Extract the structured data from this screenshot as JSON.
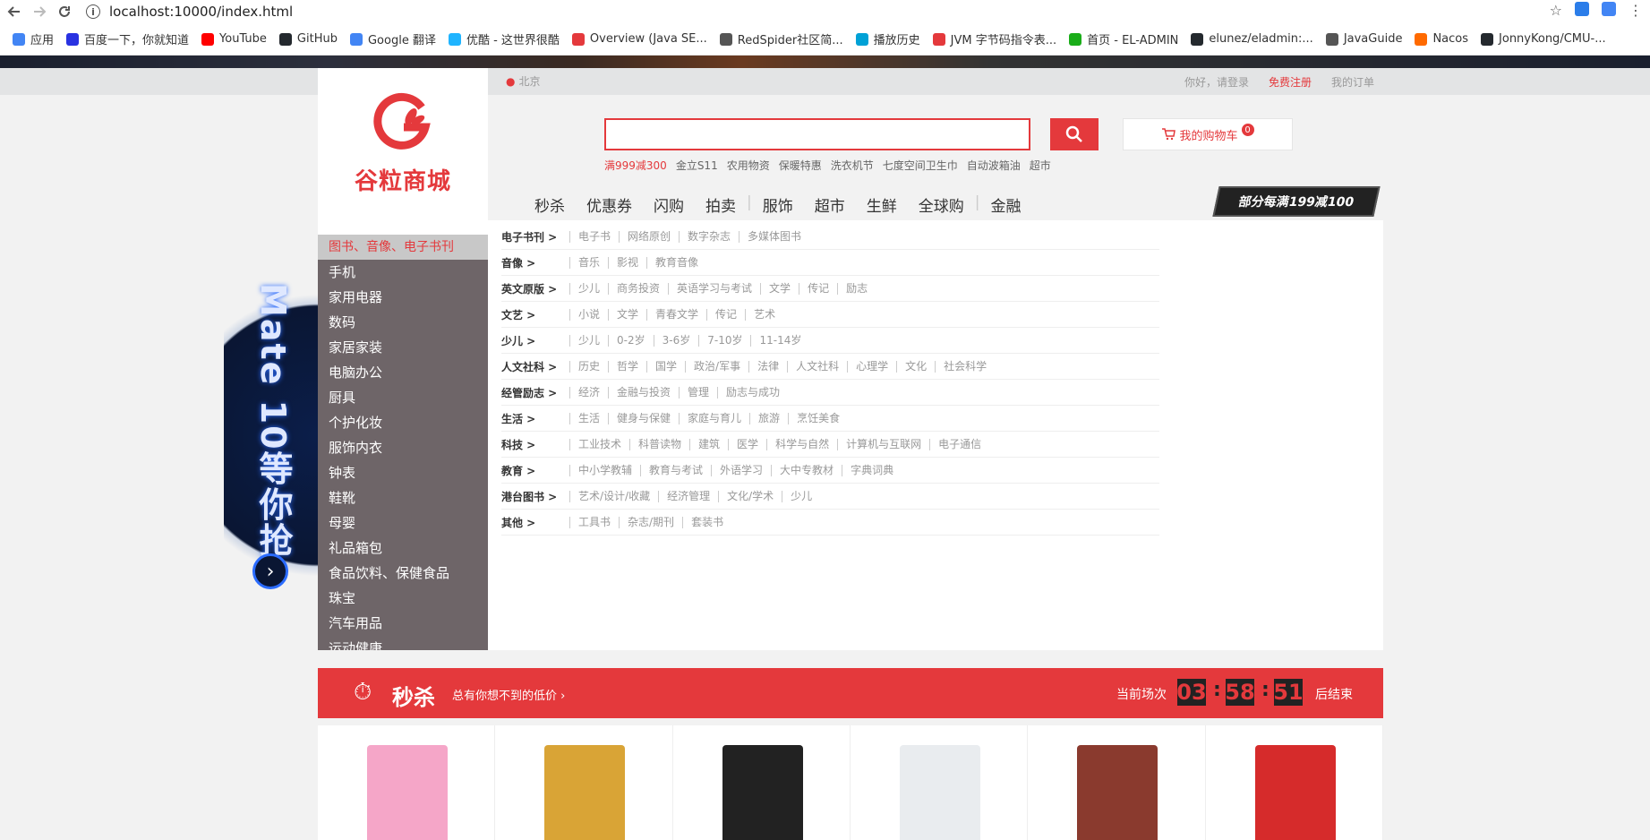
{
  "browser": {
    "url": "localhost:10000/index.html",
    "bookmarks": [
      {
        "label": "应用",
        "color": "#4285f4"
      },
      {
        "label": "百度一下，你就知道",
        "color": "#2932e1"
      },
      {
        "label": "YouTube",
        "color": "#ff0000"
      },
      {
        "label": "GitHub",
        "color": "#24292e"
      },
      {
        "label": "Google 翻译",
        "color": "#4285f4"
      },
      {
        "label": "优酷 - 这世界很酷",
        "color": "#1fb4ff"
      },
      {
        "label": "Overview (Java SE...",
        "color": "#e4393c"
      },
      {
        "label": "RedSpider社区简...",
        "color": "#555555"
      },
      {
        "label": "播放历史",
        "color": "#00a1d6"
      },
      {
        "label": "JVM 字节码指令表...",
        "color": "#e4393c"
      },
      {
        "label": "首页 - EL-ADMIN",
        "color": "#1aad19"
      },
      {
        "label": "elunez/eladmin:...",
        "color": "#24292e"
      },
      {
        "label": "JavaGuide",
        "color": "#555555"
      },
      {
        "label": "Nacos",
        "color": "#ff6a00"
      },
      {
        "label": "JonnyKong/CMU-...",
        "color": "#24292e"
      }
    ]
  },
  "top": {
    "location": "北京",
    "greeting": "你好，请登录",
    "register": "免费注册",
    "orders": "我的订单"
  },
  "header": {
    "logo_text": "谷粒商城",
    "cart_label": "我的购物车",
    "cart_count": "0",
    "hotwords": [
      "满999减300",
      "金立S11",
      "农用物资",
      "保暖特惠",
      "洗衣机节",
      "七度空间卫生巾",
      "自动波箱油",
      "超市"
    ],
    "nav": [
      "秒杀",
      "优惠券",
      "闪购",
      "拍卖",
      "服饰",
      "超市",
      "生鲜",
      "全球购",
      "金融"
    ],
    "promo": "部分每满199减100"
  },
  "hero": {
    "text": "Mate 10等你抢"
  },
  "categories": [
    "图书、音像、电子书刊",
    "手机",
    "家用电器",
    "数码",
    "家居家装",
    "电脑办公",
    "厨具",
    "个护化妆",
    "服饰内衣",
    "钟表",
    "鞋靴",
    "母婴",
    "礼品箱包",
    "食品饮料、保健食品",
    "珠宝",
    "汽车用品",
    "运动健康"
  ],
  "subcategories": [
    {
      "title": "电子书刊 >",
      "items": [
        "电子书",
        "网络原创",
        "数字杂志",
        "多媒体图书"
      ]
    },
    {
      "title": "音像 >",
      "items": [
        "音乐",
        "影视",
        "教育音像"
      ]
    },
    {
      "title": "英文原版 >",
      "items": [
        "少儿",
        "商务投资",
        "英语学习与考试",
        "文学",
        "传记",
        "励志"
      ]
    },
    {
      "title": "文艺 >",
      "items": [
        "小说",
        "文学",
        "青春文学",
        "传记",
        "艺术"
      ]
    },
    {
      "title": "少儿 >",
      "items": [
        "少儿",
        "0-2岁",
        "3-6岁",
        "7-10岁",
        "11-14岁"
      ]
    },
    {
      "title": "人文社科 >",
      "items": [
        "历史",
        "哲学",
        "国学",
        "政治/军事",
        "法律",
        "人文社科",
        "心理学",
        "文化",
        "社会科学"
      ]
    },
    {
      "title": "经管励志 >",
      "items": [
        "经济",
        "金融与投资",
        "管理",
        "励志与成功"
      ]
    },
    {
      "title": "生活 >",
      "items": [
        "生活",
        "健身与保健",
        "家庭与育儿",
        "旅游",
        "烹饪美食"
      ]
    },
    {
      "title": "科技 >",
      "items": [
        "工业技术",
        "科普读物",
        "建筑",
        "医学",
        "科学与自然",
        "计算机与互联网",
        "电子通信"
      ]
    },
    {
      "title": "教育 >",
      "items": [
        "中小学教辅",
        "教育与考试",
        "外语学习",
        "大中专教材",
        "字典词典"
      ]
    },
    {
      "title": "港台图书 >",
      "items": [
        "艺术/设计/收藏",
        "经济管理",
        "文化/学术",
        "少儿"
      ]
    },
    {
      "title": "其他 >",
      "items": [
        "工具书",
        "杂志/期刊",
        "套装书"
      ]
    }
  ],
  "seckill": {
    "title": "秒杀",
    "subtitle": "总有你想不到的低价",
    "current": "当前场次",
    "h": "03",
    "m": "58",
    "s": "51",
    "end": "后结束"
  },
  "products": [
    {
      "name": "diaper-product",
      "color": "#f5a6c8"
    },
    {
      "name": "paint-product",
      "color": "#d9a436"
    },
    {
      "name": "dashcam-product",
      "color": "#222222"
    },
    {
      "name": "aircon-product",
      "color": "#e9ecef"
    },
    {
      "name": "meat-product",
      "color": "#8a3a2e"
    },
    {
      "name": "sneaker-product",
      "color": "#d62b2b"
    }
  ]
}
